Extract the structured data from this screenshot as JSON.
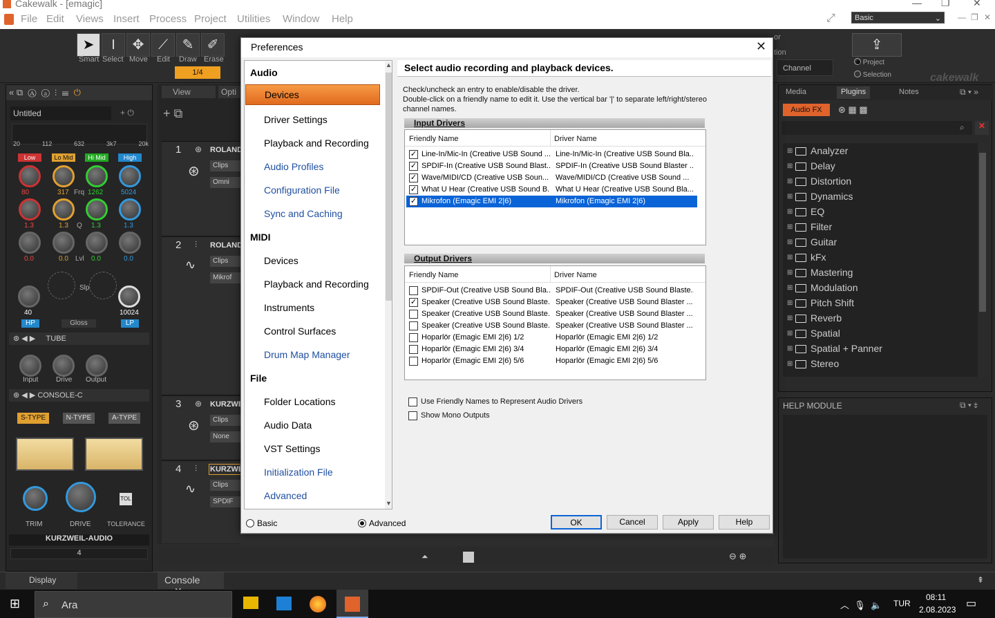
{
  "titlebar": {
    "title": "Cakewalk - [emagic]"
  },
  "menu": [
    "File",
    "Edit",
    "Views",
    "Insert",
    "Process",
    "Project",
    "Utilities",
    "Window",
    "Help"
  ],
  "workspace": "Basic",
  "tools": [
    {
      "label": "Smart",
      "glyph": "➤"
    },
    {
      "label": "Select",
      "glyph": "I"
    },
    {
      "label": "Move",
      "glyph": "✥"
    },
    {
      "label": "Edit",
      "glyph": "⟋"
    },
    {
      "label": "Draw",
      "glyph": "✎"
    },
    {
      "label": "Erase",
      "glyph": "✐"
    }
  ],
  "snap": "1/4",
  "toolbar_right": {
    "channel": "Channel",
    "radio1": "Project",
    "radio2": "Selection",
    "logo": "cakewalk",
    "partial1": "or",
    "partial2": "tion"
  },
  "inspector": {
    "track_name": "Untitled",
    "scale": [
      "20",
      "112",
      "632",
      "3k7",
      "20k"
    ],
    "bands": [
      "Low",
      "Lo Mid",
      "Hi Mid",
      "High"
    ],
    "freq": [
      "80",
      "317",
      "Frq",
      "1262",
      "5024"
    ],
    "q": [
      "1.3",
      "1.3",
      "Q",
      "1.3",
      "1.3"
    ],
    "lvl": [
      "0.0",
      "0.0",
      "Lvl",
      "0.0",
      "0.0"
    ],
    "hp": "40",
    "lp": "10024",
    "hp_label": "HP",
    "gloss": "Gloss",
    "lp_label": "LP",
    "slp": "Slp",
    "slot1": "TUBE",
    "knobs1": [
      "Input",
      "Drive",
      "Output"
    ],
    "slot2": "CONSOLE-C",
    "types": [
      "S-TYPE",
      "N-TYPE",
      "A-TYPE"
    ],
    "meter_lbl": [
      "TRIM",
      "DRIVE",
      "TOLERANCE"
    ],
    "tol": "TOL",
    "brand": "KURZWEIL-AUDIO",
    "num": "4"
  },
  "trackview": {
    "view": "View",
    "opti": "Opti",
    "tracks": [
      {
        "num": "1",
        "name": "ROLAND",
        "clips": "Clips",
        "input": "Omni"
      },
      {
        "num": "2",
        "name": "ROLAND",
        "clips": "Clips",
        "input": "Mikrof"
      },
      {
        "num": "3",
        "name": "KURZWE",
        "clips": "Clips",
        "input": "None"
      },
      {
        "num": "4",
        "name": "KURZWE",
        "clips": "Clips",
        "input": "SPDIF"
      }
    ]
  },
  "browser": {
    "tabs": [
      "Media",
      "Plugins",
      "Notes"
    ],
    "audiofx": "Audio FX",
    "items": [
      "Analyzer",
      "Delay",
      "Distortion",
      "Dynamics",
      "EQ",
      "Filter",
      "Guitar",
      "kFx",
      "Mastering",
      "Modulation",
      "Pitch Shift",
      "Reverb",
      "Spatial",
      "Spatial + Panner",
      "Stereo"
    ]
  },
  "help": {
    "title": "HELP MODULE"
  },
  "bottom": {
    "display": "Display",
    "console": "Console"
  },
  "taskbar": {
    "search": "Ara",
    "lang": "TUR",
    "time": "08:11",
    "date": "2.08.2023"
  },
  "dialog": {
    "title": "Preferences",
    "tree": {
      "audio": "Audio",
      "audio_items": [
        "Devices",
        "Driver Settings",
        "Playback and Recording",
        "Audio Profiles",
        "Configuration File",
        "Sync and Caching"
      ],
      "midi": "MIDI",
      "midi_items": [
        "Devices",
        "Playback and Recording",
        "Instruments",
        "Control Surfaces",
        "Drum Map Manager"
      ],
      "file": "File",
      "file_items": [
        "Folder Locations",
        "Audio Data",
        "VST Settings",
        "Initialization File",
        "Advanced"
      ]
    },
    "content_title": "Select audio recording and playback devices.",
    "desc1": "Check/uncheck an entry to enable/disable the driver.",
    "desc2": "Double-click on a friendly name to edit it. Use the vertical bar '|' to separate left/right/stereo",
    "desc3": "channel names.",
    "input_hdr": "Input Drivers",
    "output_hdr": "Output Drivers",
    "col_friendly": "Friendly Name",
    "col_driver": "Driver Name",
    "inputs": [
      {
        "checked": true,
        "f": "Line-In/Mic-In (Creative USB Sound ...",
        "d": "Line-In/Mic-In (Creative USB Sound Bla..."
      },
      {
        "checked": true,
        "f": "SPDIF-In (Creative USB Sound Blast...",
        "d": "SPDIF-In (Creative USB Sound Blaster ..."
      },
      {
        "checked": true,
        "f": "Wave/MIDI/CD (Creative USB Soun...",
        "d": "Wave/MIDI/CD (Creative USB Sound ..."
      },
      {
        "checked": true,
        "f": "What U Hear (Creative USB Sound B...",
        "d": "What U Hear (Creative USB Sound Bla..."
      },
      {
        "checked": true,
        "f": "Mikrofon (Emagic EMI 2|6)",
        "d": "Mikrofon (Emagic EMI 2|6)"
      }
    ],
    "outputs": [
      {
        "checked": false,
        "f": "SPDIF-Out (Creative USB Sound Bla...",
        "d": "SPDIF-Out (Creative USB Sound Blaste..."
      },
      {
        "checked": true,
        "f": "Speaker (Creative USB Sound Blaste...",
        "d": "Speaker (Creative USB Sound Blaster ..."
      },
      {
        "checked": false,
        "f": "Speaker (Creative USB Sound Blaste...",
        "d": "Speaker (Creative USB Sound Blaster ..."
      },
      {
        "checked": false,
        "f": "Speaker (Creative USB Sound Blaste...",
        "d": "Speaker (Creative USB Sound Blaster ..."
      },
      {
        "checked": false,
        "f": "Hoparlör (Emagic EMI 2|6) 1/2",
        "d": "Hoparlör (Emagic EMI 2|6) 1/2"
      },
      {
        "checked": false,
        "f": "Hoparlör (Emagic EMI 2|6) 3/4",
        "d": "Hoparlör (Emagic EMI 2|6) 3/4"
      },
      {
        "checked": false,
        "f": "Hoparlör (Emagic EMI 2|6) 5/6",
        "d": "Hoparlör (Emagic EMI 2|6) 5/6"
      }
    ],
    "opt1": "Use Friendly Names to Represent Audio Drivers",
    "opt2": "Show Mono Outputs",
    "radio_basic": "Basic",
    "radio_advanced": "Advanced",
    "buttons": [
      "OK",
      "Cancel",
      "Apply",
      "Help"
    ]
  }
}
